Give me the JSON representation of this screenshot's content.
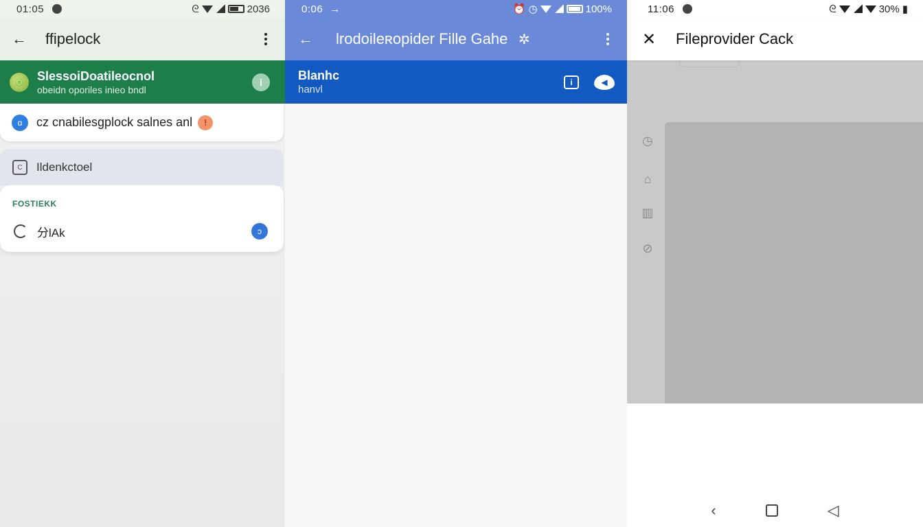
{
  "panel1": {
    "status": {
      "time": "01:05",
      "right_text": "2036"
    },
    "appbar": {
      "title": "ffipelock"
    },
    "account": {
      "name": "SlessoiDoatileocnol",
      "subtitle": "obeidn oporiles inieo bndl",
      "avatar_text": "ⓔ",
      "info_glyph": "i"
    },
    "card1": {
      "label": "cz cnabilesgplock salnes anl",
      "icon_glyph": "ɑ",
      "badge_glyph": "!"
    },
    "row": {
      "label": "Ildenkctoel",
      "icon_glyph": "C"
    },
    "section": {
      "header": "FOSTIEKK",
      "item_label": "分lAk",
      "toggle_glyph": "ↄ"
    }
  },
  "panel2": {
    "status": {
      "time": "0:06",
      "right_text": "100%"
    },
    "appbar": {
      "title": "lrodoileʀopider Fille Gahe"
    },
    "banner": {
      "title": "Blanhc",
      "subtitle": "hanvl",
      "action1_glyph": "i",
      "action2_glyph": "◀"
    }
  },
  "panel3": {
    "status": {
      "time": "11:06",
      "right_text": "30%"
    },
    "appbar": {
      "title": "Fileprovider Cack"
    }
  },
  "colors": {
    "green": "#1e7e4a",
    "blue_banner": "#1359c2",
    "periwinkle": "#6a8ad9",
    "scrim": "#c9c9c9"
  }
}
